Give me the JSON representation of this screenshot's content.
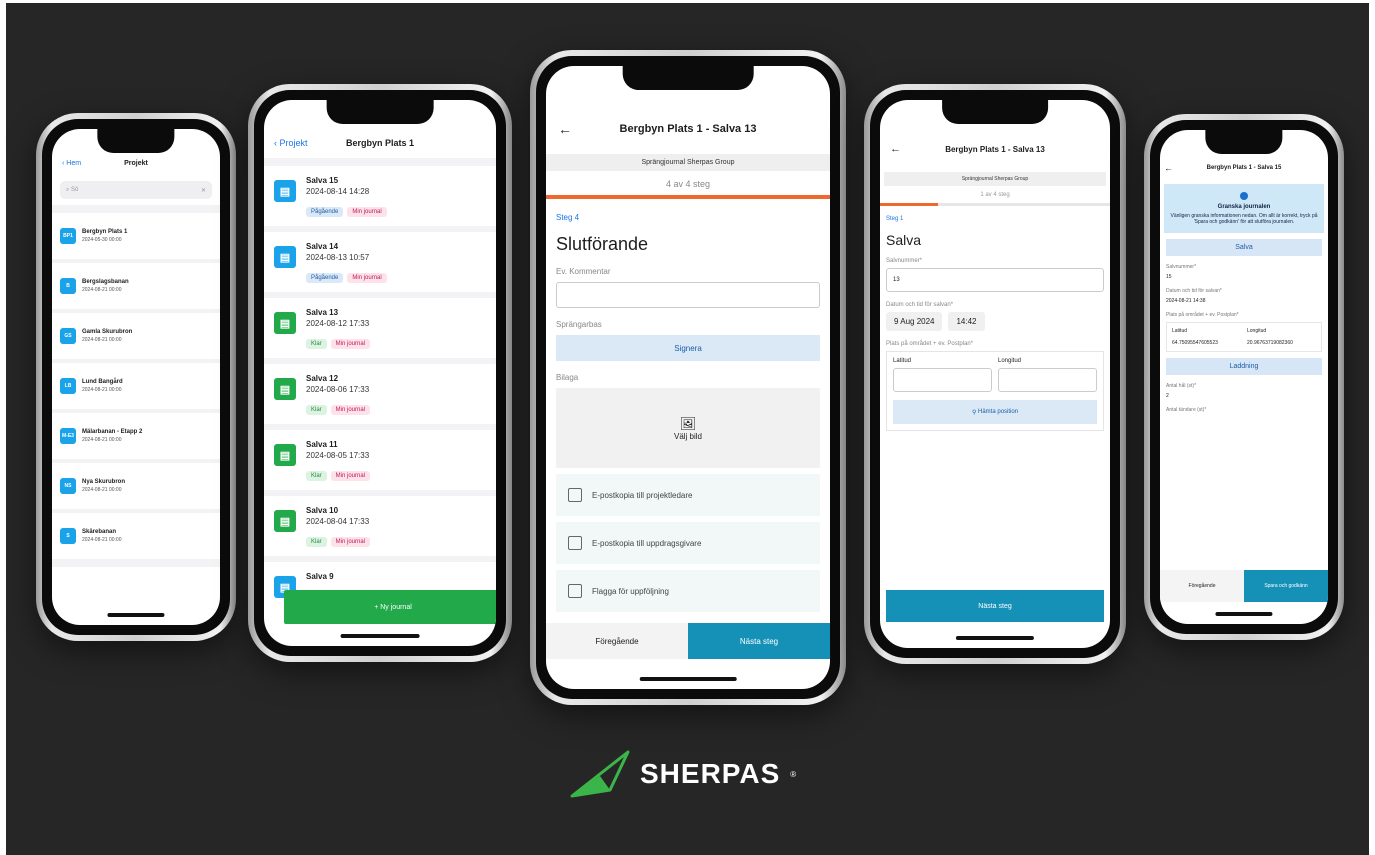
{
  "phone1": {
    "back": "Hem",
    "title": "Projekt",
    "search_placeholder": "Sö",
    "projects": [
      {
        "icon": "BP1",
        "name": "Bergbyn Plats 1",
        "date": "2024-05-30 00:00"
      },
      {
        "icon": "B",
        "name": "Bergslagsbanan",
        "date": "2024-08-21 00:00"
      },
      {
        "icon": "GS",
        "name": "Gamla Skurubron",
        "date": "2024-08-21 00:00"
      },
      {
        "icon": "LB",
        "name": "Lund Bangård",
        "date": "2024-08-21 00:00"
      },
      {
        "icon": "M-E3",
        "name": "Mälarbanan - Etapp 2",
        "date": "2024-08-21 00:00"
      },
      {
        "icon": "NS",
        "name": "Nya Skurubron",
        "date": "2024-08-21 00:00"
      },
      {
        "icon": "S",
        "name": "Skärebanan",
        "date": "2024-08-21 00:00"
      }
    ]
  },
  "phone2": {
    "back": "Projekt",
    "title": "Bergbyn Plats 1",
    "journals": [
      {
        "name": "Salva 15",
        "date": "2024-08-14 14:28",
        "status": "Pågående",
        "tag": "Min journal",
        "color": "blue"
      },
      {
        "name": "Salva 14",
        "date": "2024-08-13 10:57",
        "status": "Pågående",
        "tag": "Min journal",
        "color": "blue"
      },
      {
        "name": "Salva 13",
        "date": "2024-08-12 17:33",
        "status": "Klar",
        "tag": "Min journal",
        "color": "green"
      },
      {
        "name": "Salva 12",
        "date": "2024-08-06 17:33",
        "status": "Klar",
        "tag": "Min journal",
        "color": "green"
      },
      {
        "name": "Salva 11",
        "date": "2024-08-05 17:33",
        "status": "Klar",
        "tag": "Min journal",
        "color": "green"
      },
      {
        "name": "Salva 10",
        "date": "2024-08-04 17:33",
        "status": "Klar",
        "tag": "Min journal",
        "color": "green"
      },
      {
        "name": "Salva 9",
        "date": "",
        "status": "",
        "tag": "",
        "color": "blue"
      }
    ],
    "new_button": "+ Ny journal"
  },
  "phone3": {
    "title": "Bergbyn Plats 1 - Salva 13",
    "company": "Sprängjournal Sherpas Group",
    "step_text": "4 av 4 steg",
    "progress": 1.0,
    "step_label": "Steg 4",
    "heading": "Slutförande",
    "comment_label": "Ev. Kommentar",
    "foreman_label": "Sprängarbas",
    "sign_button": "Signera",
    "attachment_label": "Bilaga",
    "choose_image": "Välj bild",
    "checks": [
      "E-postkopia till projektledare",
      "E-postkopia till uppdragsgivare",
      "Flagga för uppföljning"
    ],
    "prev_button": "Föregående",
    "next_button": "Nästa steg"
  },
  "phone4": {
    "title": "Bergbyn Plats 1 - Salva 13",
    "company": "Sprängjournal Sherpas Group",
    "step_text": "1 av 4 steg",
    "progress": 0.25,
    "step_label": "Steg 1",
    "heading": "Salva",
    "salvo_label": "Salvnummer*",
    "salvo_value": "13",
    "datetime_label": "Datum och tid för salvan*",
    "date_value": "9 Aug 2024",
    "time_value": "14:42",
    "position_label": "Plats på området + ev. Postplan*",
    "lat_label": "Latitud",
    "lon_label": "Longitud",
    "fetch_button": "Hämta position",
    "next_button": "Nästa steg"
  },
  "phone5": {
    "title": "Bergbyn Plats 1 - Salva 15",
    "info_title": "Granska journalen",
    "info_text": "Vänligen granska informationen nedan. Om allt är korrekt, tryck på 'Spara och godkänn' för att slutföra journalen.",
    "section1": "Salva",
    "salvo_label": "Salvnummer*",
    "salvo_value": "15",
    "datetime_label": "Datum och tid för salvan*",
    "datetime_value": "2024-08-21 14:38",
    "position_label": "Plats på området + ev. Postplan*",
    "lat_label": "Latitud",
    "lon_label": "Longitud",
    "lat_value": "64.75095547605523",
    "lon_value": "20.96763719082360",
    "section2": "Laddning",
    "holes_label": "Antal hål (st)*",
    "holes_value": "2",
    "det_label": "Antal tändare (st)*",
    "prev_button": "Föregående",
    "save_button": "Spara och godkänn"
  },
  "brand": {
    "name": "SHERPAS",
    "reg": "®",
    "color": "#3bb54a"
  }
}
